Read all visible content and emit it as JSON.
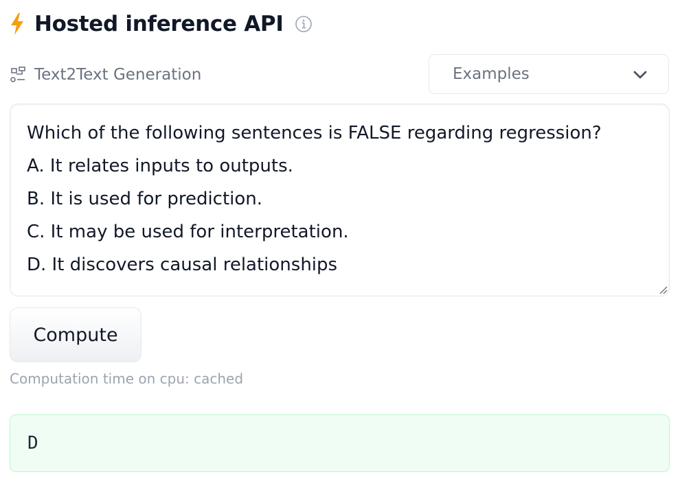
{
  "header": {
    "title": "Hosted inference API",
    "bolt_icon": "lightning-bolt-icon",
    "info_icon": "info-circle-icon",
    "accent_color": "#f59e0b"
  },
  "task": {
    "icon": "text2text-task-icon",
    "label": "Text2Text Generation"
  },
  "examples": {
    "label": "Examples",
    "icon": "chevron-down-icon"
  },
  "input": {
    "lines": [
      "Which of the following sentences is FALSE regarding regression?",
      "A. It relates inputs to outputs.",
      "B. It is used for prediction.",
      "C. It may be used for interpretation.",
      "D. It discovers causal relationships"
    ]
  },
  "compute": {
    "label": "Compute"
  },
  "status": {
    "computation_time": "Computation time on cpu: cached"
  },
  "output": {
    "text": "D",
    "background_color": "#f0fdf4",
    "border_color": "#bbf7d0"
  }
}
